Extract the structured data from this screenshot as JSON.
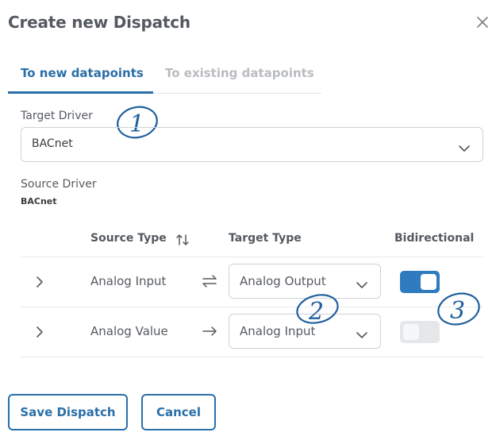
{
  "dialog": {
    "title": "Create new Dispatch"
  },
  "tabs": [
    {
      "label": "To new datapoints",
      "active": true
    },
    {
      "label": "To existing datapoints",
      "active": false
    }
  ],
  "target_driver": {
    "label": "Target Driver",
    "value": "BACnet"
  },
  "source_driver": {
    "label": "Source Driver",
    "value": "BACnet"
  },
  "table": {
    "headers": {
      "source_type": "Source Type",
      "target_type": "Target Type",
      "bidirectional": "Bidirectional"
    },
    "rows": [
      {
        "source": "Analog Input",
        "direction": "bidirectional-arrows-icon",
        "target": "Analog Output",
        "bidirectional": true
      },
      {
        "source": "Analog Value",
        "direction": "right-arrow-icon",
        "target": "Analog Input",
        "bidirectional": false
      }
    ]
  },
  "annotations": [
    "1",
    "2",
    "3"
  ],
  "buttons": {
    "save": "Save Dispatch",
    "cancel": "Cancel"
  },
  "colors": {
    "accent": "#2a6fa8",
    "toggle_on": "#2f7bbf",
    "annotation": "#1f5f9e",
    "muted_tab": "#b9bcc0"
  }
}
